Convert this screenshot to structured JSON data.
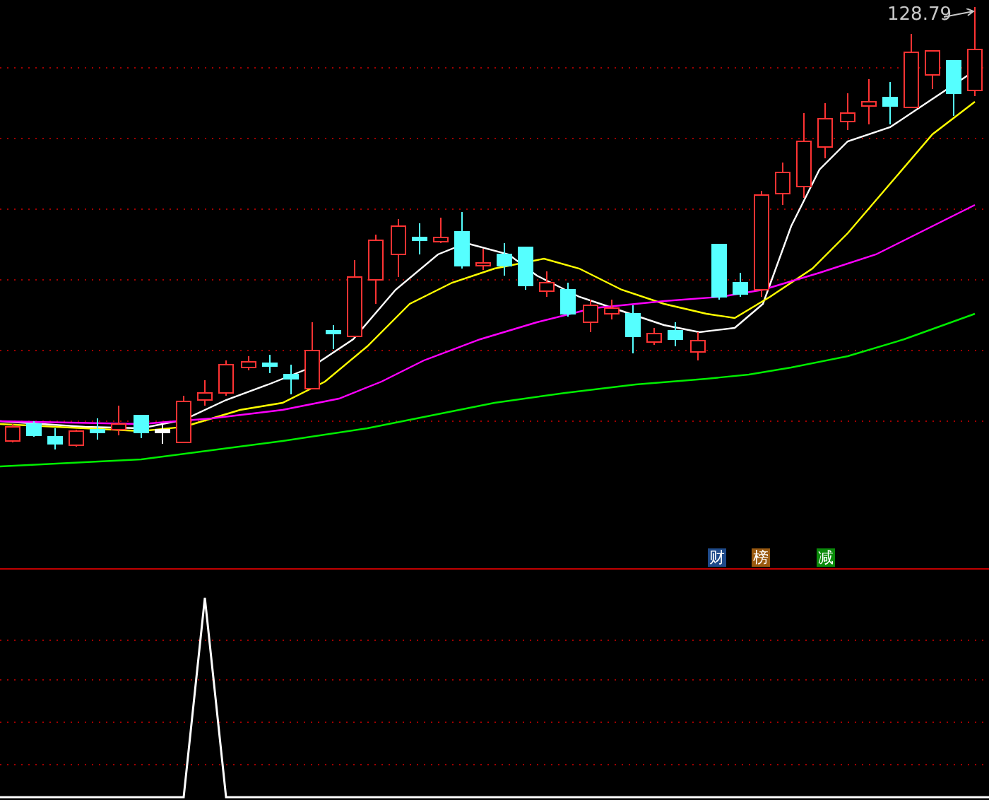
{
  "price_label": "128.79",
  "signals": [
    {
      "label": "财",
      "color": "#1e4a8a"
    },
    {
      "label": "榜",
      "color": "#9a5a10"
    },
    {
      "label": "减",
      "color": "#0a8a0a"
    }
  ]
}
